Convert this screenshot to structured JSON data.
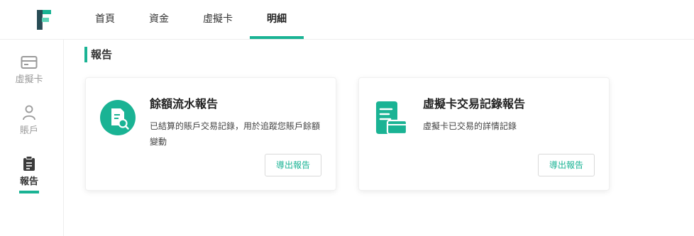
{
  "nav": {
    "tabs": [
      {
        "label": "首頁"
      },
      {
        "label": "資金"
      },
      {
        "label": "虛擬卡"
      },
      {
        "label": "明細"
      }
    ],
    "active_tab": "明細"
  },
  "sidebar": {
    "items": [
      {
        "label": "虛擬卡",
        "icon": "card-icon"
      },
      {
        "label": "賬戶",
        "icon": "user-icon"
      },
      {
        "label": "報告",
        "icon": "clipboard-icon"
      }
    ],
    "active_item": "報告"
  },
  "section": {
    "title": "報告"
  },
  "cards": [
    {
      "title": "餘額流水報告",
      "description": "已結算的賬戶交易記錄，用於追蹤您賬戶餘額變動",
      "button": "導出報告",
      "icon": "document-search-icon"
    },
    {
      "title": "虛擬卡交易記錄報告",
      "description": "虛擬卡已交易的詳情記錄",
      "button": "導出報告",
      "icon": "card-document-icon"
    }
  ],
  "colors": {
    "accent": "#1ab394",
    "sidebar_inactive": "#999999"
  }
}
